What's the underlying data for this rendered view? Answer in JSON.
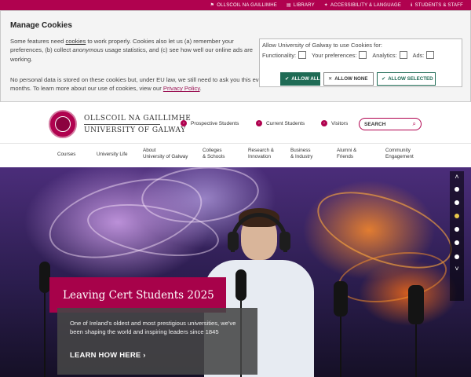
{
  "topbar": {
    "links": [
      {
        "label": "OLLSCOIL NA GAILLIMHE",
        "icon": "language-icon"
      },
      {
        "label": "LIBRARY",
        "icon": "book-icon"
      },
      {
        "label": "ACCESSIBILITY & LANGUAGE",
        "icon": "accessibility-icon"
      },
      {
        "label": "STUDENTS & STAFF",
        "icon": "info-icon"
      }
    ],
    "color": "#b0024f"
  },
  "cookie": {
    "title": "Manage Cookies",
    "p1_a": "Some features need ",
    "p1_link": "cookies",
    "p1_b": " to work properly. Cookies also let us (a) remember your preferences, (b) collect ",
    "p1_em": "anonymous",
    "p1_c": " usage statistics, and (c) see how well our online ads are working.",
    "p2_a": "No personal data is stored on these cookies but, under EU law, we still need to ask you this every 6 months. To learn more about our use of cookies, view our ",
    "p2_link": "Privacy Policy",
    "p2_b": ".",
    "box_title": "Allow University of Galway to use Cookies for:",
    "options": [
      "Functionality:",
      "Your preferences:",
      "Analytics:",
      "Ads:"
    ],
    "buttons": {
      "allow_all": "ALLOW ALL",
      "allow_none": "ALLOW NONE",
      "allow_selected": "ALLOW SELECTED"
    },
    "button_color": "#1f6b55"
  },
  "header": {
    "logo_line1": "OLLSCOIL NA GAILLIMHE",
    "logo_line2": "UNIVERSITY OF GALWAY",
    "quick_links": [
      "Prospective Students",
      "Current Students",
      "Visitors"
    ],
    "search_placeholder": "SEARCH"
  },
  "nav": {
    "items": [
      "Courses",
      "University Life",
      "About\nUniversity of Galway",
      "Colleges\n& Schools",
      "Research &\nInnovation",
      "Business\n& Industry",
      "Alumni &\nFriends",
      "Community\nEngagement"
    ]
  },
  "hero": {
    "banner_title": "Leaving Cert Students 2025",
    "description": "One of Ireland's oldest and most prestigious universities, we've been shaping the world and inspiring leaders since 1845",
    "cta": "LEARN HOW HERE",
    "slider": {
      "count": 6,
      "active_index": 2
    },
    "accent": "#a7024a"
  }
}
